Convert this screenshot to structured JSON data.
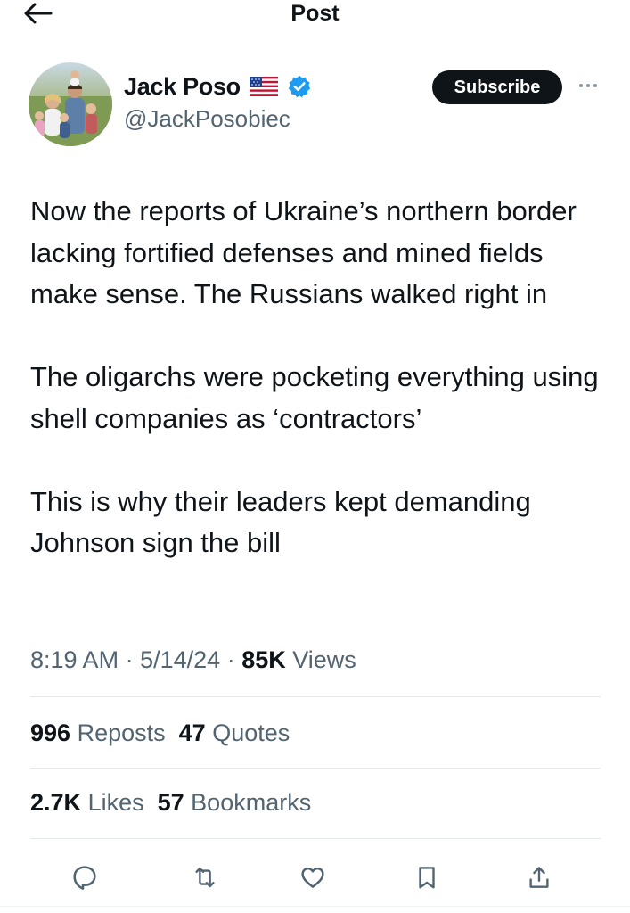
{
  "header": {
    "title": "Post",
    "back_icon": "arrow-left-icon"
  },
  "author": {
    "display_name": "Jack Poso",
    "handle": "@JackPosobiec",
    "flag_icon": "us-flag-icon",
    "verified_icon": "verified-badge-icon",
    "verified_color": "#1d9bf0"
  },
  "subscribe": {
    "label": "Subscribe"
  },
  "tweet": {
    "paragraphs": [
      "Now the reports of Ukraine’s northern border lacking fortified defenses and mined fields make sense. The Russians walked right in",
      "The oligarchs were pocketing everything using shell companies as ‘contractors’",
      "This is why their leaders kept demanding Johnson sign the bill"
    ],
    "time": "8:19 AM",
    "date": "5/14/24",
    "separator": "·",
    "views_count": "85K",
    "views_label": "Views"
  },
  "stats": {
    "reposts_count": "996",
    "reposts_label": "Reposts",
    "quotes_count": "47",
    "quotes_label": "Quotes",
    "likes_count": "2.7K",
    "likes_label": "Likes",
    "bookmarks_count": "57",
    "bookmarks_label": "Bookmarks"
  },
  "actions": {
    "icons": [
      "reply-icon",
      "repost-icon",
      "like-icon",
      "bookmark-icon",
      "share-icon"
    ]
  },
  "colors": {
    "text_primary": "#0f1419",
    "text_secondary": "#536471",
    "button_dark": "#0f1419",
    "divider": "#e6e9eb"
  }
}
